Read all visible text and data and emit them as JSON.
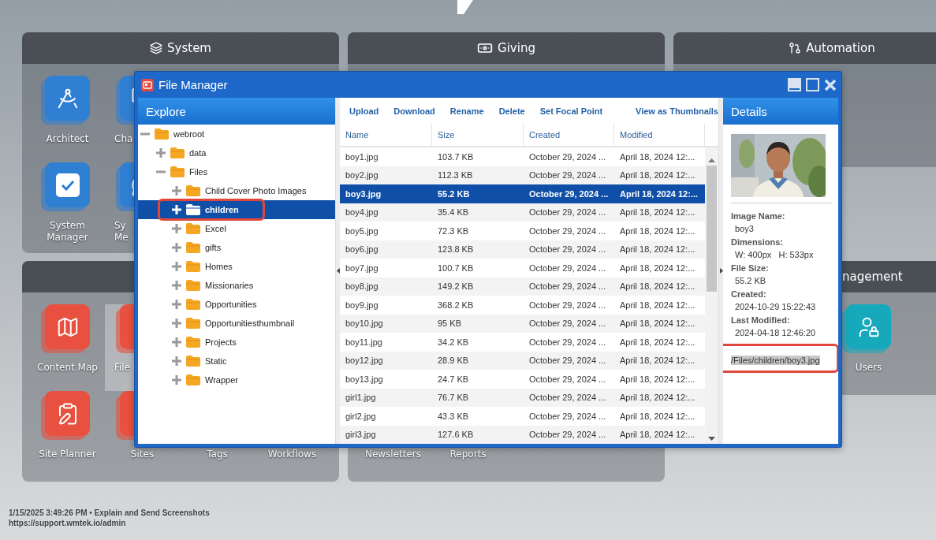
{
  "cards": [
    {
      "title": "System",
      "color": "#2f7fd3",
      "tiles": [
        {
          "label_lines": [
            "Architect"
          ],
          "kind": "app",
          "highlighted": false
        },
        {
          "label_lines": [
            "Cha"
          ],
          "kind": "app_cut",
          "highlighted": false
        },
        {
          "label_lines": [
            "System",
            "Manager"
          ],
          "kind": "app",
          "highlighted": false
        },
        {
          "label_lines": [
            "Sy",
            "Me"
          ],
          "kind": "app_cut",
          "highlighted": false
        }
      ]
    },
    {
      "title": "Giving"
    },
    {
      "title": "Automation"
    },
    {
      "color": "#e8503f",
      "tiles": [
        {
          "label_lines": [
            "Content Map"
          ],
          "kind": "app",
          "highlighted": false
        },
        {
          "label_lines": [
            "File"
          ],
          "kind": "app_cut",
          "highlighted": true
        },
        {
          "label_lines": [
            "Site Planner"
          ],
          "kind": "app",
          "highlighted": false
        },
        {
          "label_lines": [
            "Sites"
          ],
          "kind": "app",
          "highlighted": false
        },
        {
          "label_lines": [
            "Tags"
          ],
          "kind": "label",
          "highlighted": false
        },
        {
          "label_lines": [
            "Workflows"
          ],
          "kind": "label",
          "highlighted": false
        }
      ]
    },
    {
      "tiles": [
        {
          "label_lines": [
            "Newsletters"
          ],
          "kind": "label",
          "highlighted": false
        },
        {
          "label_lines": [
            "Reports"
          ],
          "kind": "label",
          "highlighted": false
        }
      ]
    },
    {
      "title": "nagement",
      "color": "#16a9bb",
      "tiles": [
        {
          "label_lines": [
            "Users"
          ],
          "kind": "app",
          "highlighted": false
        }
      ]
    }
  ],
  "file_manager": {
    "title": "File Manager",
    "explore": {
      "title": "Explore",
      "tree": [
        {
          "label": "webroot",
          "expanded": true,
          "selected": false,
          "callout": false,
          "children": [
            {
              "label": "data",
              "expanded": false,
              "selected": false,
              "callout": false
            },
            {
              "label": "Files",
              "expanded": true,
              "selected": false,
              "callout": false,
              "children": [
                {
                  "label": "Child Cover Photo Images",
                  "expanded": false,
                  "selected": false,
                  "callout": false
                },
                {
                  "label": "children",
                  "expanded": false,
                  "selected": true,
                  "callout": true
                },
                {
                  "label": "Excel",
                  "expanded": false,
                  "selected": false,
                  "callout": false
                },
                {
                  "label": "gifts",
                  "expanded": false,
                  "selected": false,
                  "callout": false
                },
                {
                  "label": "Homes",
                  "expanded": false,
                  "selected": false,
                  "callout": false
                },
                {
                  "label": "Missionaries",
                  "expanded": false,
                  "selected": false,
                  "callout": false
                },
                {
                  "label": "Opportunities",
                  "expanded": false,
                  "selected": false,
                  "callout": false
                },
                {
                  "label": "Opportunitiesthumbnail",
                  "expanded": false,
                  "selected": false,
                  "callout": false
                },
                {
                  "label": "Projects",
                  "expanded": false,
                  "selected": false,
                  "callout": false
                },
                {
                  "label": "Static",
                  "expanded": false,
                  "selected": false,
                  "callout": false
                },
                {
                  "label": "Wrapper",
                  "expanded": false,
                  "selected": false,
                  "callout": false
                }
              ]
            }
          ]
        }
      ]
    },
    "toolbar": [
      "Upload",
      "Download",
      "Rename",
      "Delete",
      "Set Focal Point",
      "View as Thumbnails"
    ],
    "table": {
      "columns": [
        "Name",
        "Size",
        "Created",
        "Modified"
      ],
      "rows": [
        {
          "cells": [
            "boy1.jpg",
            "103.7 KB",
            "October 29, 2024 ...",
            "April 18, 2024 12:..."
          ],
          "selected": false
        },
        {
          "cells": [
            "boy2.jpg",
            "112.3 KB",
            "October 29, 2024 ...",
            "April 18, 2024 12:..."
          ],
          "selected": false
        },
        {
          "cells": [
            "boy3.jpg",
            "55.2 KB",
            "October 29, 2024 ...",
            "April 18, 2024 12:..."
          ],
          "selected": true
        },
        {
          "cells": [
            "boy4.jpg",
            "35.4 KB",
            "October 29, 2024 ...",
            "April 18, 2024 12:..."
          ],
          "selected": false
        },
        {
          "cells": [
            "boy5.jpg",
            "72.3 KB",
            "October 29, 2024 ...",
            "April 18, 2024 12:..."
          ],
          "selected": false
        },
        {
          "cells": [
            "boy6.jpg",
            "123.8 KB",
            "October 29, 2024 ...",
            "April 18, 2024 12:..."
          ],
          "selected": false
        },
        {
          "cells": [
            "boy7.jpg",
            "100.7 KB",
            "October 29, 2024 ...",
            "April 18, 2024 12:..."
          ],
          "selected": false
        },
        {
          "cells": [
            "boy8.jpg",
            "149.2 KB",
            "October 29, 2024 ...",
            "April 18, 2024 12:..."
          ],
          "selected": false
        },
        {
          "cells": [
            "boy9.jpg",
            "368.2 KB",
            "October 29, 2024 ...",
            "April 18, 2024 12:..."
          ],
          "selected": false
        },
        {
          "cells": [
            "boy10.jpg",
            "95 KB",
            "October 29, 2024 ...",
            "April 18, 2024 12:..."
          ],
          "selected": false
        },
        {
          "cells": [
            "boy11.jpg",
            "34.2 KB",
            "October 29, 2024 ...",
            "April 18, 2024 12:..."
          ],
          "selected": false
        },
        {
          "cells": [
            "boy12.jpg",
            "28.9 KB",
            "October 29, 2024 ...",
            "April 18, 2024 12:..."
          ],
          "selected": false
        },
        {
          "cells": [
            "boy13.jpg",
            "24.7 KB",
            "October 29, 2024 ...",
            "April 18, 2024 12:..."
          ],
          "selected": false
        },
        {
          "cells": [
            "girl1.jpg",
            "76.7 KB",
            "October 29, 2024 ...",
            "April 18, 2024 12:..."
          ],
          "selected": false
        },
        {
          "cells": [
            "girl2.jpg",
            "43.3 KB",
            "October 29, 2024 ...",
            "April 18, 2024 12:..."
          ],
          "selected": false
        },
        {
          "cells": [
            "girl3.jpg",
            "127.6 KB",
            "October 29, 2024 ...",
            "April 18, 2024 12:..."
          ],
          "selected": false
        }
      ]
    },
    "details": {
      "title": "Details",
      "fields": [
        {
          "label": "Image Name:",
          "value": "boy3"
        },
        {
          "label": "Dimensions:",
          "value": "W: 400px   H: 533px"
        },
        {
          "label": "File Size:",
          "value": "55.2 KB"
        },
        {
          "label": "Created:",
          "value": "2024-10-29 15:22:43"
        },
        {
          "label": "Last Modified:",
          "value": "2024-04-18 12:46:20"
        }
      ],
      "path": {
        "value": "/Files/children/boy3.jpg",
        "highlighted": true,
        "callout": true
      }
    }
  },
  "status_lines": [
    "1/15/2025 3:49:26 PM • Explain and Send Screenshots",
    "https://support.wmtek.io/admin"
  ]
}
